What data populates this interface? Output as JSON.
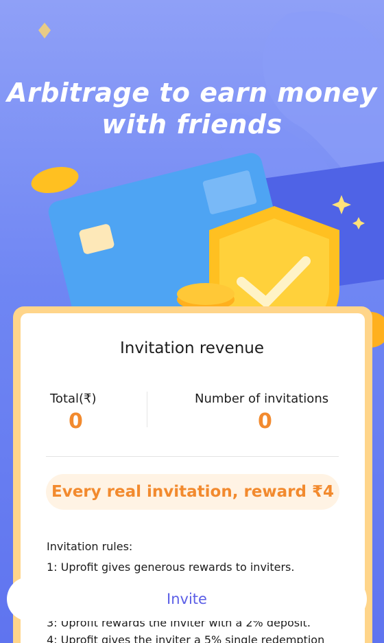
{
  "hero": {
    "headline_line1": "Arbitrage to earn money",
    "headline_line2": "with friends"
  },
  "revenue": {
    "title": "Invitation revenue",
    "total_label": "Total(₹)",
    "total_value": "0",
    "invites_label": "Number of invitations",
    "invites_value": "0"
  },
  "reward_banner": "Every real invitation, reward ₹4",
  "rules": {
    "title": "Invitation rules:",
    "items": [
      "1: Uprofit gives generous rewards to inviters.",
      "3: Uprofit rewards the inviter with a 2% deposit.",
      "4: Uprofit gives the inviter a 5% single redemption"
    ]
  },
  "invite_button": "Invite",
  "colors": {
    "accent_orange": "#f28a2e",
    "invite_text": "#5b5ee6",
    "hero_blue": "#6f86f3",
    "card_frame": "#ffd58a"
  },
  "icons": [
    "coin-icon",
    "credit-card-icon",
    "shield-check-icon",
    "sparkle-icon"
  ]
}
